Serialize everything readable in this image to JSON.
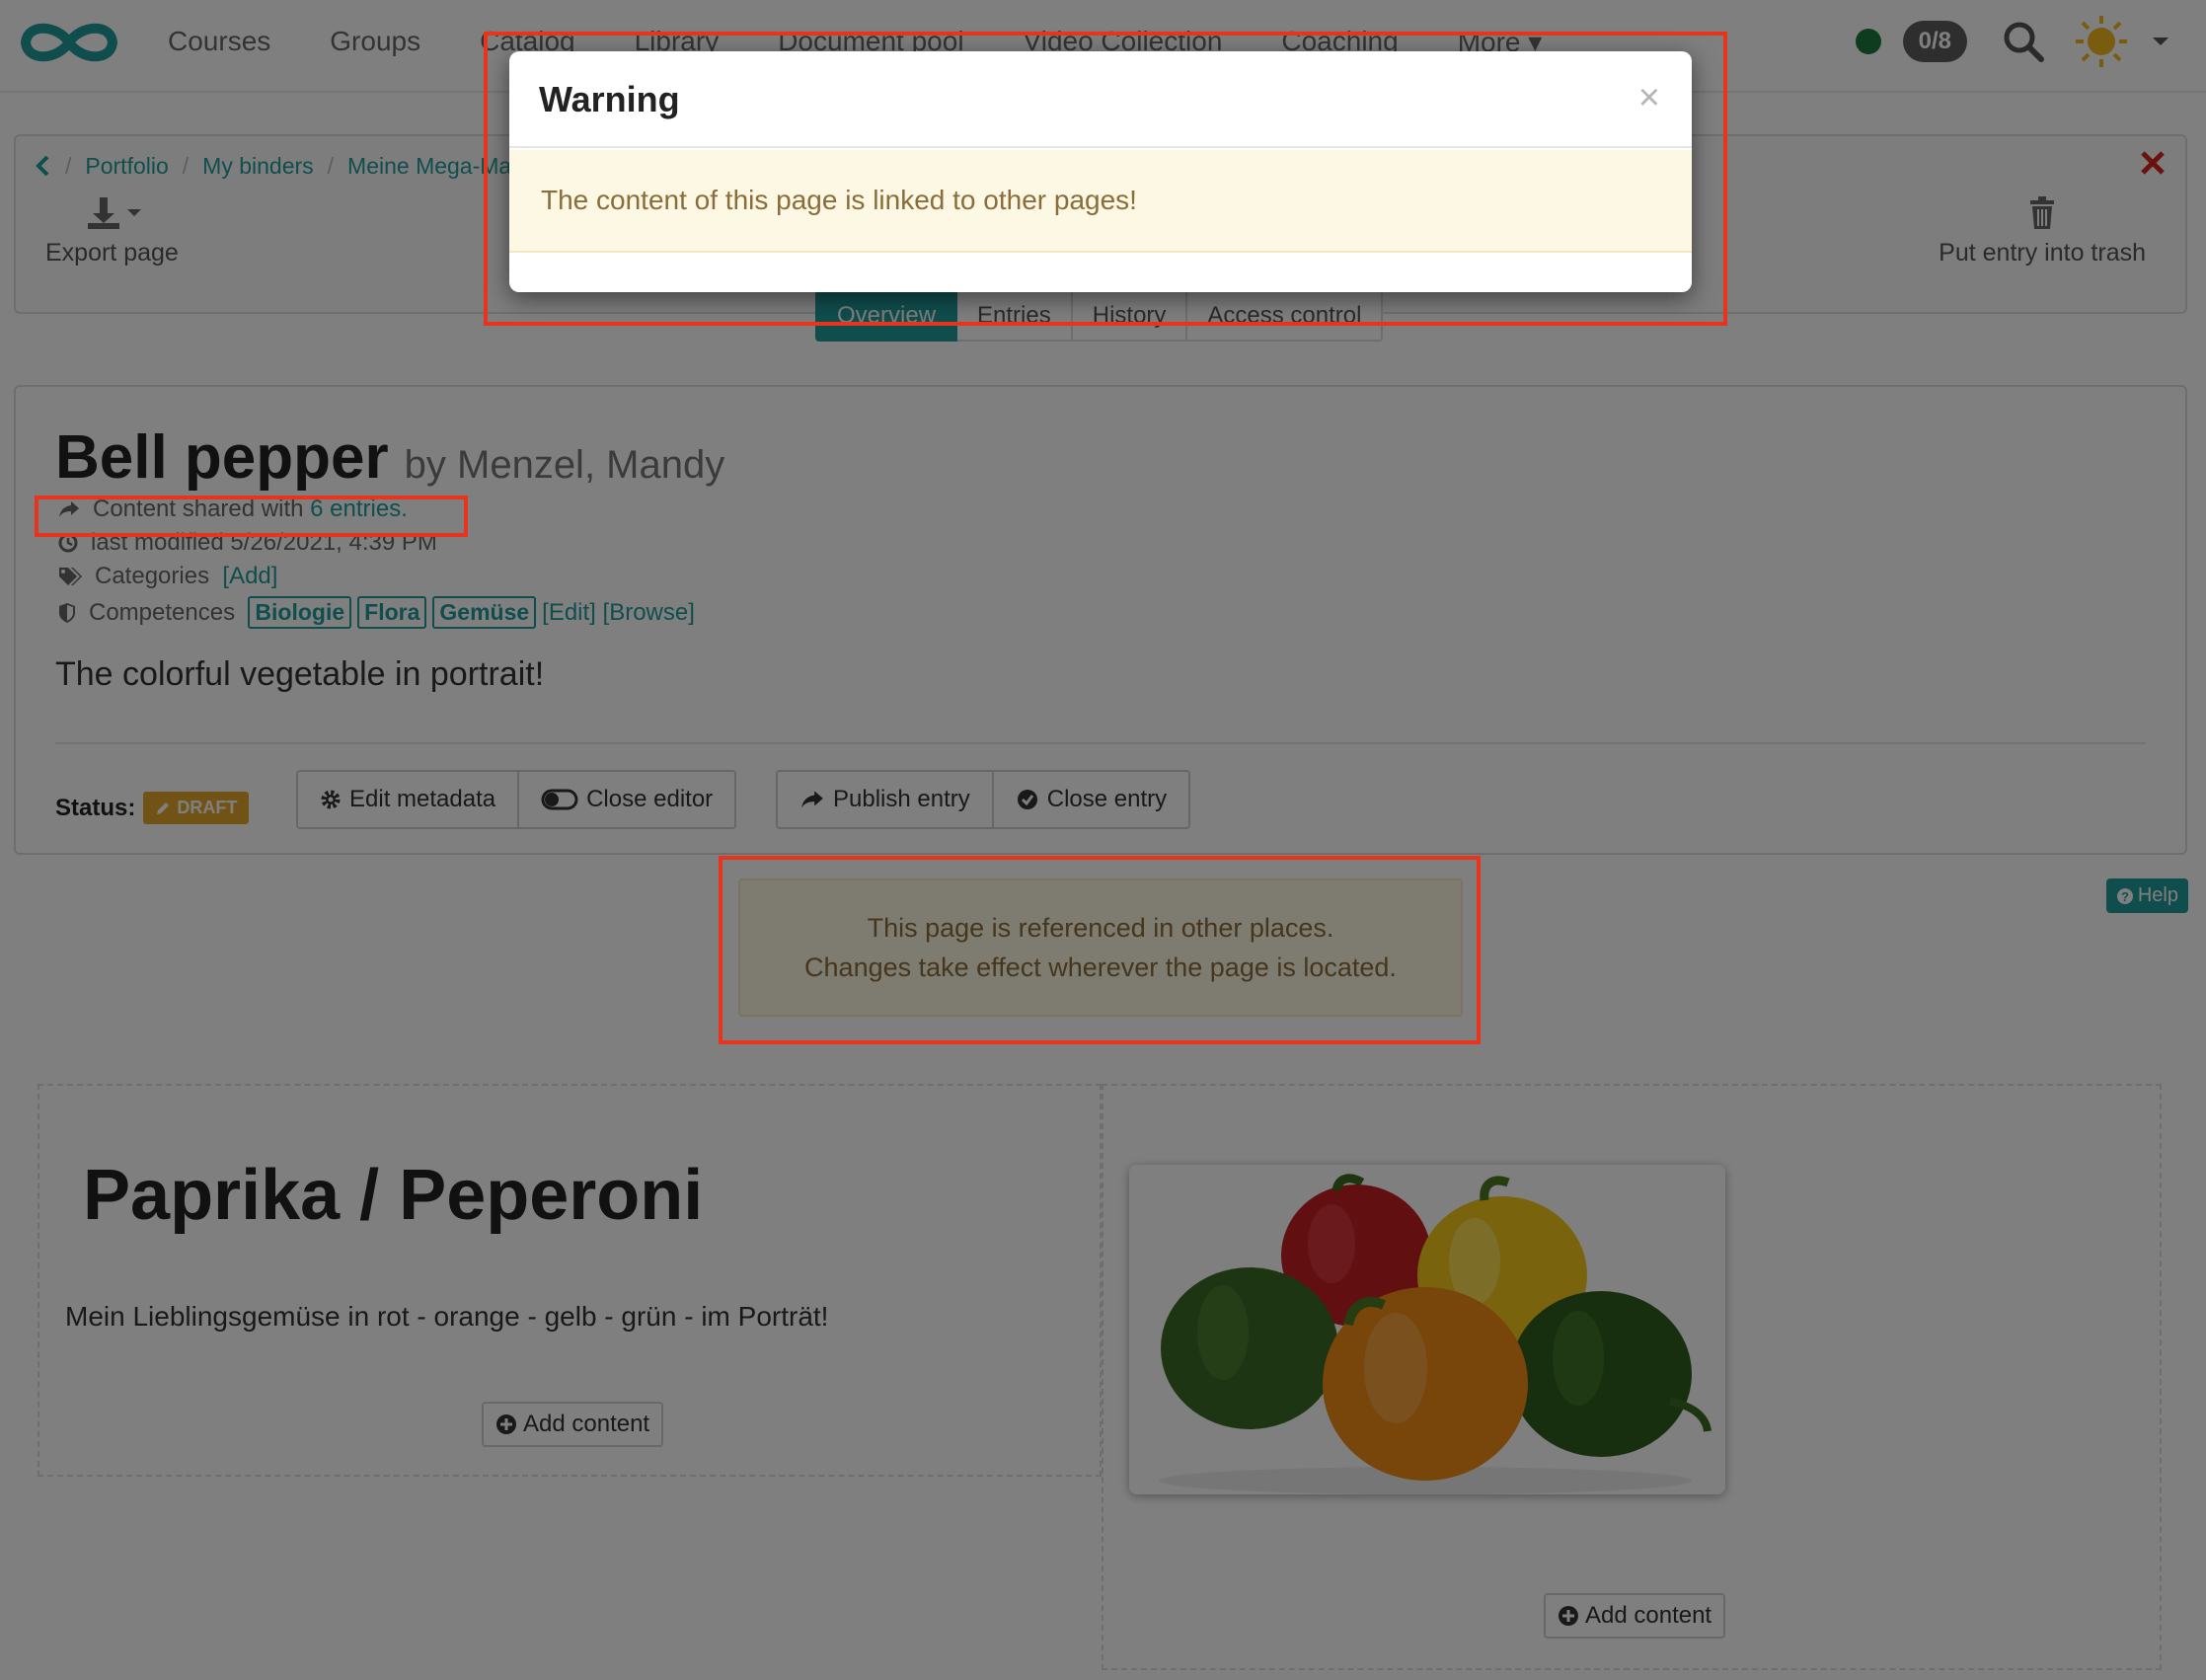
{
  "navbar": {
    "items": [
      "Courses",
      "Groups",
      "Catalog",
      "Library",
      "Document pool",
      "Video Collection",
      "Coaching",
      "More"
    ],
    "count_badge": "0/8"
  },
  "breadcrumb": {
    "items": [
      "Portfolio",
      "My binders",
      "Meine Mega-Map"
    ]
  },
  "toolbar": {
    "export_label": "Export page",
    "trash_label": "Put entry into trash"
  },
  "tabs": [
    "Overview",
    "Entries",
    "History",
    "Access control"
  ],
  "entry": {
    "title": "Bell pepper",
    "author": "by Menzel, Mandy",
    "shared_prefix": "Content shared with",
    "shared_link": "6 entries.",
    "last_modified": "last modified 5/26/2021, 4:39 PM",
    "categories_label": "Categories",
    "categories_add": "[Add]",
    "competences_label": "Competences",
    "competences": [
      "Biologie",
      "Flora",
      "Gemüse"
    ],
    "competences_edit": "[Edit]",
    "competences_browse": "[Browse]",
    "summary": "The colorful vegetable in portrait!",
    "status_label": "Status:",
    "status_value": "DRAFT",
    "buttons": {
      "edit_metadata": "Edit metadata",
      "close_editor": "Close editor",
      "publish_entry": "Publish entry",
      "close_entry": "Close entry"
    }
  },
  "info_box": {
    "line1": "This page is referenced in other places.",
    "line2": "Changes take effect wherever the page is located."
  },
  "help_label": "Help",
  "content": {
    "heading": "Paprika / Peperoni",
    "text": "Mein Lieblingsgemüse in rot - orange - gelb - grün - im Porträt!",
    "add_content_label": "Add content"
  },
  "modal": {
    "title": "Warning",
    "close": "×",
    "message": "The content of this page is linked to other pages!"
  },
  "colors": {
    "accent": "#209d9d",
    "highlight": "#e8341c",
    "warning_bg": "#fcf8e3",
    "draft_badge": "#e5a62c"
  }
}
